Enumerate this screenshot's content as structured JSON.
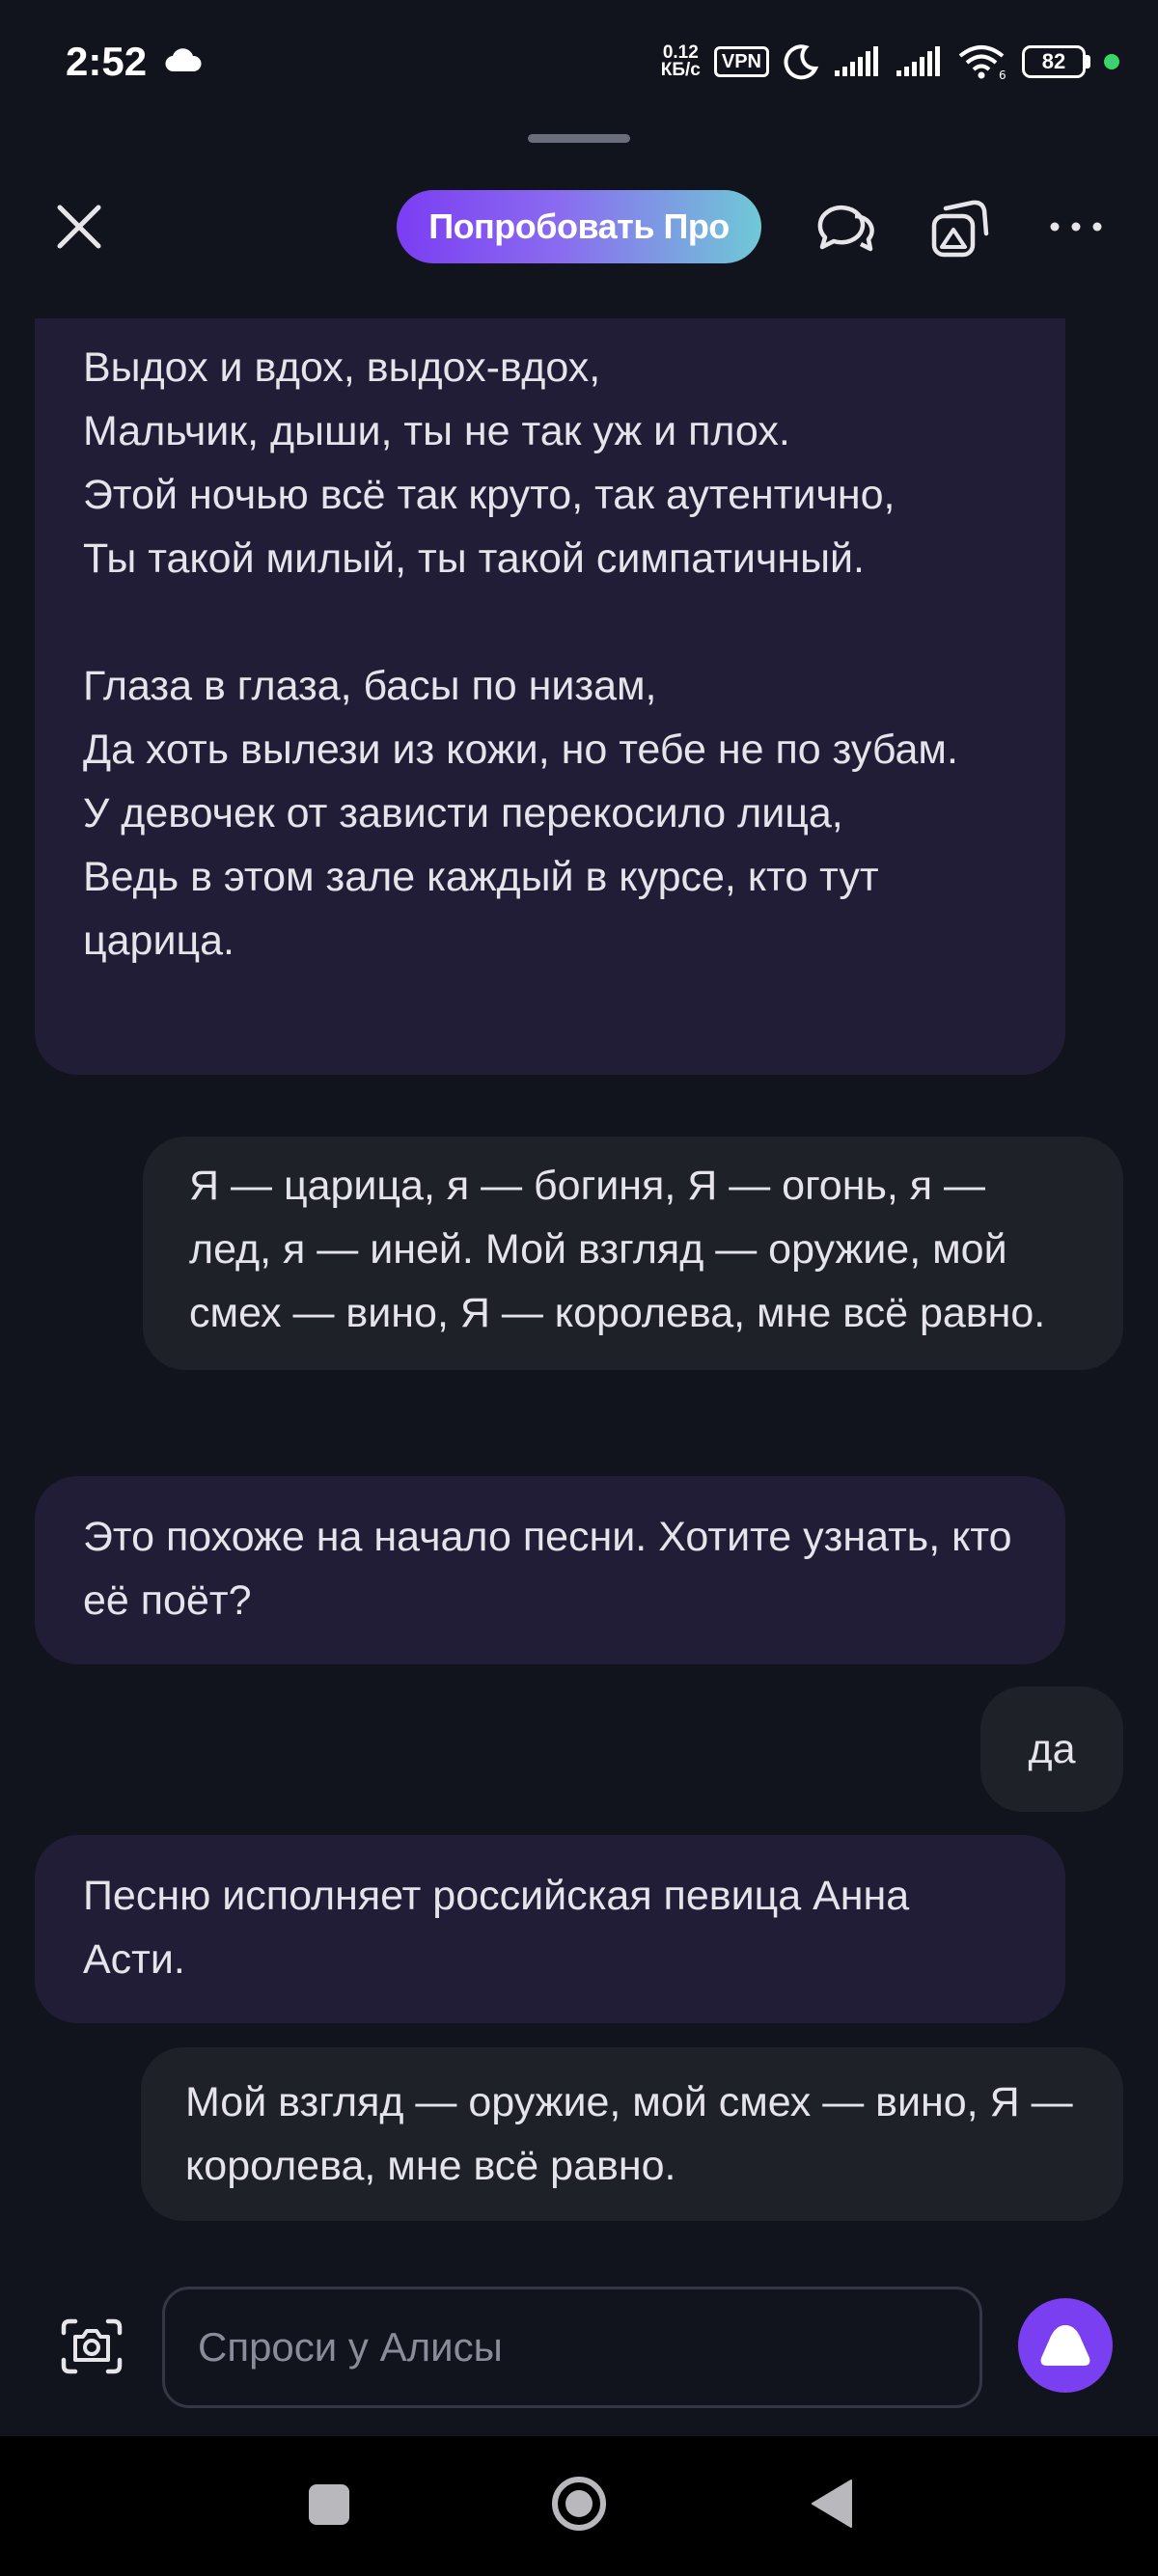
{
  "status_bar": {
    "time": "2:52",
    "net_speed_value": "0.12",
    "net_speed_unit": "КБ/с",
    "vpn": "VPN",
    "battery": "82"
  },
  "top_bar": {
    "pro_button": "Попробовать Про"
  },
  "messages": [
    {
      "from": "alice",
      "text": "Выдох и вдох, выдох-вдох,\nМальчик, дыши, ты не так уж и плох.\nЭтой ночью всё так круто, так аутентично,\nТы такой милый, ты такой симпатичный.\n\nГлаза в глаза, басы по низам,\nДа хоть вылези из кожи, но тебе не по зубам.\nУ девочек от зависти перекосило лица,\nВедь в этом зале каждый в курсе, кто тут царица."
    },
    {
      "from": "user",
      "text": "Я — царица, я — богиня, Я — огонь, я — лед, я — иней. Мой взгляд — оружие, мой смех — вино, Я — королева, мне всё равно."
    },
    {
      "from": "alice",
      "text": "Это похоже на начало песни. Хотите узнать, кто её поёт?"
    },
    {
      "from": "user",
      "text": "да"
    },
    {
      "from": "alice",
      "text": "Песню исполняет российская певица Анна Асти."
    },
    {
      "from": "user",
      "text": "Мой взгляд — оружие, мой смех — вино, Я — королева, мне всё равно."
    }
  ],
  "input": {
    "placeholder": "Спроси у Алисы"
  },
  "colors": {
    "background": "#12141d",
    "alice_bubble": "#211d36",
    "user_bubble": "#1f2129",
    "accent": "#7a3ff0"
  },
  "icons": [
    "cloud-icon",
    "vpn-icon",
    "moon-icon",
    "signal-icon",
    "wifi-icon",
    "battery-icon",
    "close-icon",
    "chat-icon",
    "gallery-icon",
    "more-icon",
    "camera-icon",
    "alice-icon",
    "recent-apps-icon",
    "home-icon",
    "back-icon"
  ]
}
